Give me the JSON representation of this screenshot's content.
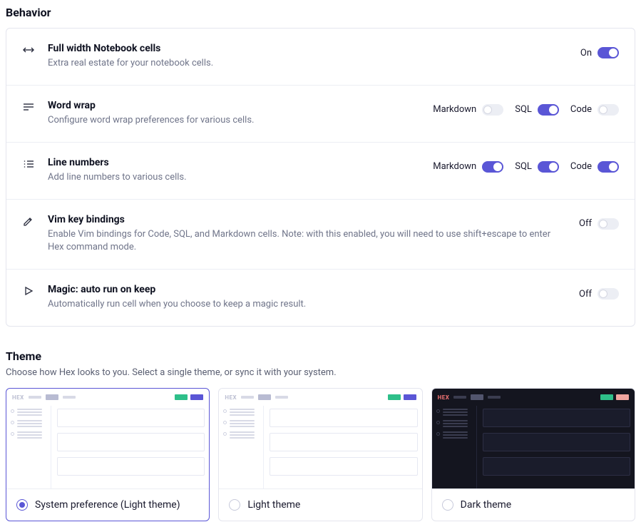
{
  "sections": {
    "behavior": {
      "title": "Behavior",
      "rows": {
        "fullwidth": {
          "title": "Full width Notebook cells",
          "desc": "Extra real estate for your notebook cells.",
          "state_label": "On",
          "on": true
        },
        "wordwrap": {
          "title": "Word wrap",
          "desc": "Configure word wrap preferences for various cells.",
          "options": {
            "markdown": {
              "label": "Markdown",
              "on": false
            },
            "sql": {
              "label": "SQL",
              "on": true
            },
            "code": {
              "label": "Code",
              "on": false
            }
          }
        },
        "linenumbers": {
          "title": "Line numbers",
          "desc": "Add line numbers to various cells.",
          "options": {
            "markdown": {
              "label": "Markdown",
              "on": true
            },
            "sql": {
              "label": "SQL",
              "on": true
            },
            "code": {
              "label": "Code",
              "on": true
            }
          }
        },
        "vim": {
          "title": "Vim key bindings",
          "desc": "Enable Vim bindings for Code, SQL, and Markdown cells. Note: with this enabled, you will need to use shift+escape to enter Hex command mode.",
          "state_label": "Off",
          "on": false
        },
        "magic": {
          "title": "Magic: auto run on keep",
          "desc": "Automatically run cell when you choose to keep a magic result.",
          "state_label": "Off",
          "on": false
        }
      }
    },
    "theme": {
      "title": "Theme",
      "desc": "Choose how Hex looks to you. Select a single theme, or sync it with your system.",
      "options": {
        "system": {
          "label": "System preference (Light theme)",
          "selected": true,
          "variant": "light"
        },
        "light": {
          "label": "Light theme",
          "selected": false,
          "variant": "light"
        },
        "dark": {
          "label": "Dark theme",
          "selected": false,
          "variant": "dark"
        }
      }
    }
  }
}
